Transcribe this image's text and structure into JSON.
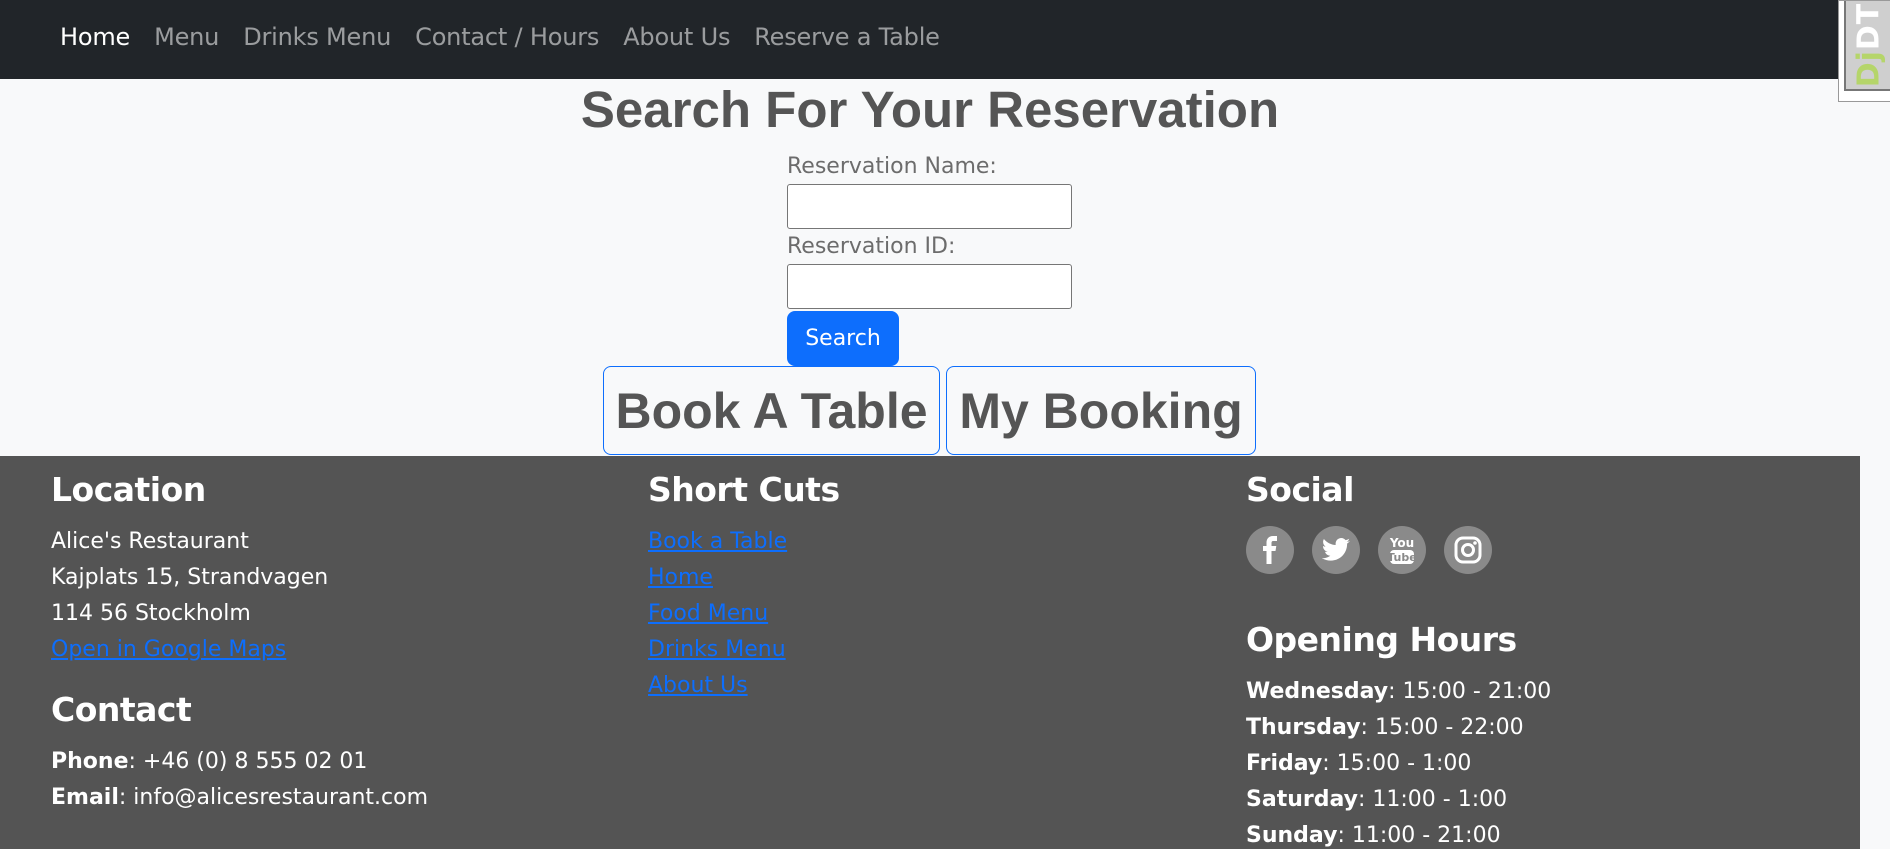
{
  "nav": {
    "items": [
      {
        "label": "Home"
      },
      {
        "label": "Menu"
      },
      {
        "label": "Drinks Menu"
      },
      {
        "label": "Contact / Hours"
      },
      {
        "label": "About Us"
      },
      {
        "label": "Reserve a Table"
      }
    ]
  },
  "debug_toolbar": {
    "label": "DjDT"
  },
  "page": {
    "title": "Search For Your Reservation",
    "name_label": "Reservation Name:",
    "name_value": "",
    "id_label": "Reservation ID:",
    "id_value": "",
    "search_button": "Search",
    "book_button": "Book A Table",
    "my_booking_button": "My Booking"
  },
  "footer": {
    "location": {
      "heading": "Location",
      "name": "Alice's Restaurant",
      "street": "Kajplats 15, Strandvagen",
      "city": "114 56 Stockholm",
      "maps_link": "Open in Google Maps"
    },
    "contact": {
      "heading": "Contact",
      "phone_label": "Phone",
      "phone": ": +46 (0) 8 555 02 01",
      "email_label": "Email",
      "email": ": info@alicesrestaurant.com"
    },
    "shortcuts": {
      "heading": "Short Cuts",
      "links": [
        "Book a Table",
        "Home",
        "Food Menu",
        "Drinks Menu",
        "About Us"
      ]
    },
    "social": {
      "heading": "Social",
      "icons": [
        "facebook-icon",
        "twitter-icon",
        "youtube-icon",
        "instagram-icon"
      ]
    },
    "hours": {
      "heading": "Opening Hours",
      "days": [
        {
          "day": "Wednesday",
          "time": ": 15:00 - 21:00"
        },
        {
          "day": "Thursday",
          "time": ": 15:00 - 22:00"
        },
        {
          "day": "Friday",
          "time": ": 15:00 - 1:00"
        },
        {
          "day": "Saturday",
          "time": ": 11:00 - 1:00"
        },
        {
          "day": "Sunday",
          "time": ": 11:00 - 21:00"
        }
      ]
    }
  }
}
